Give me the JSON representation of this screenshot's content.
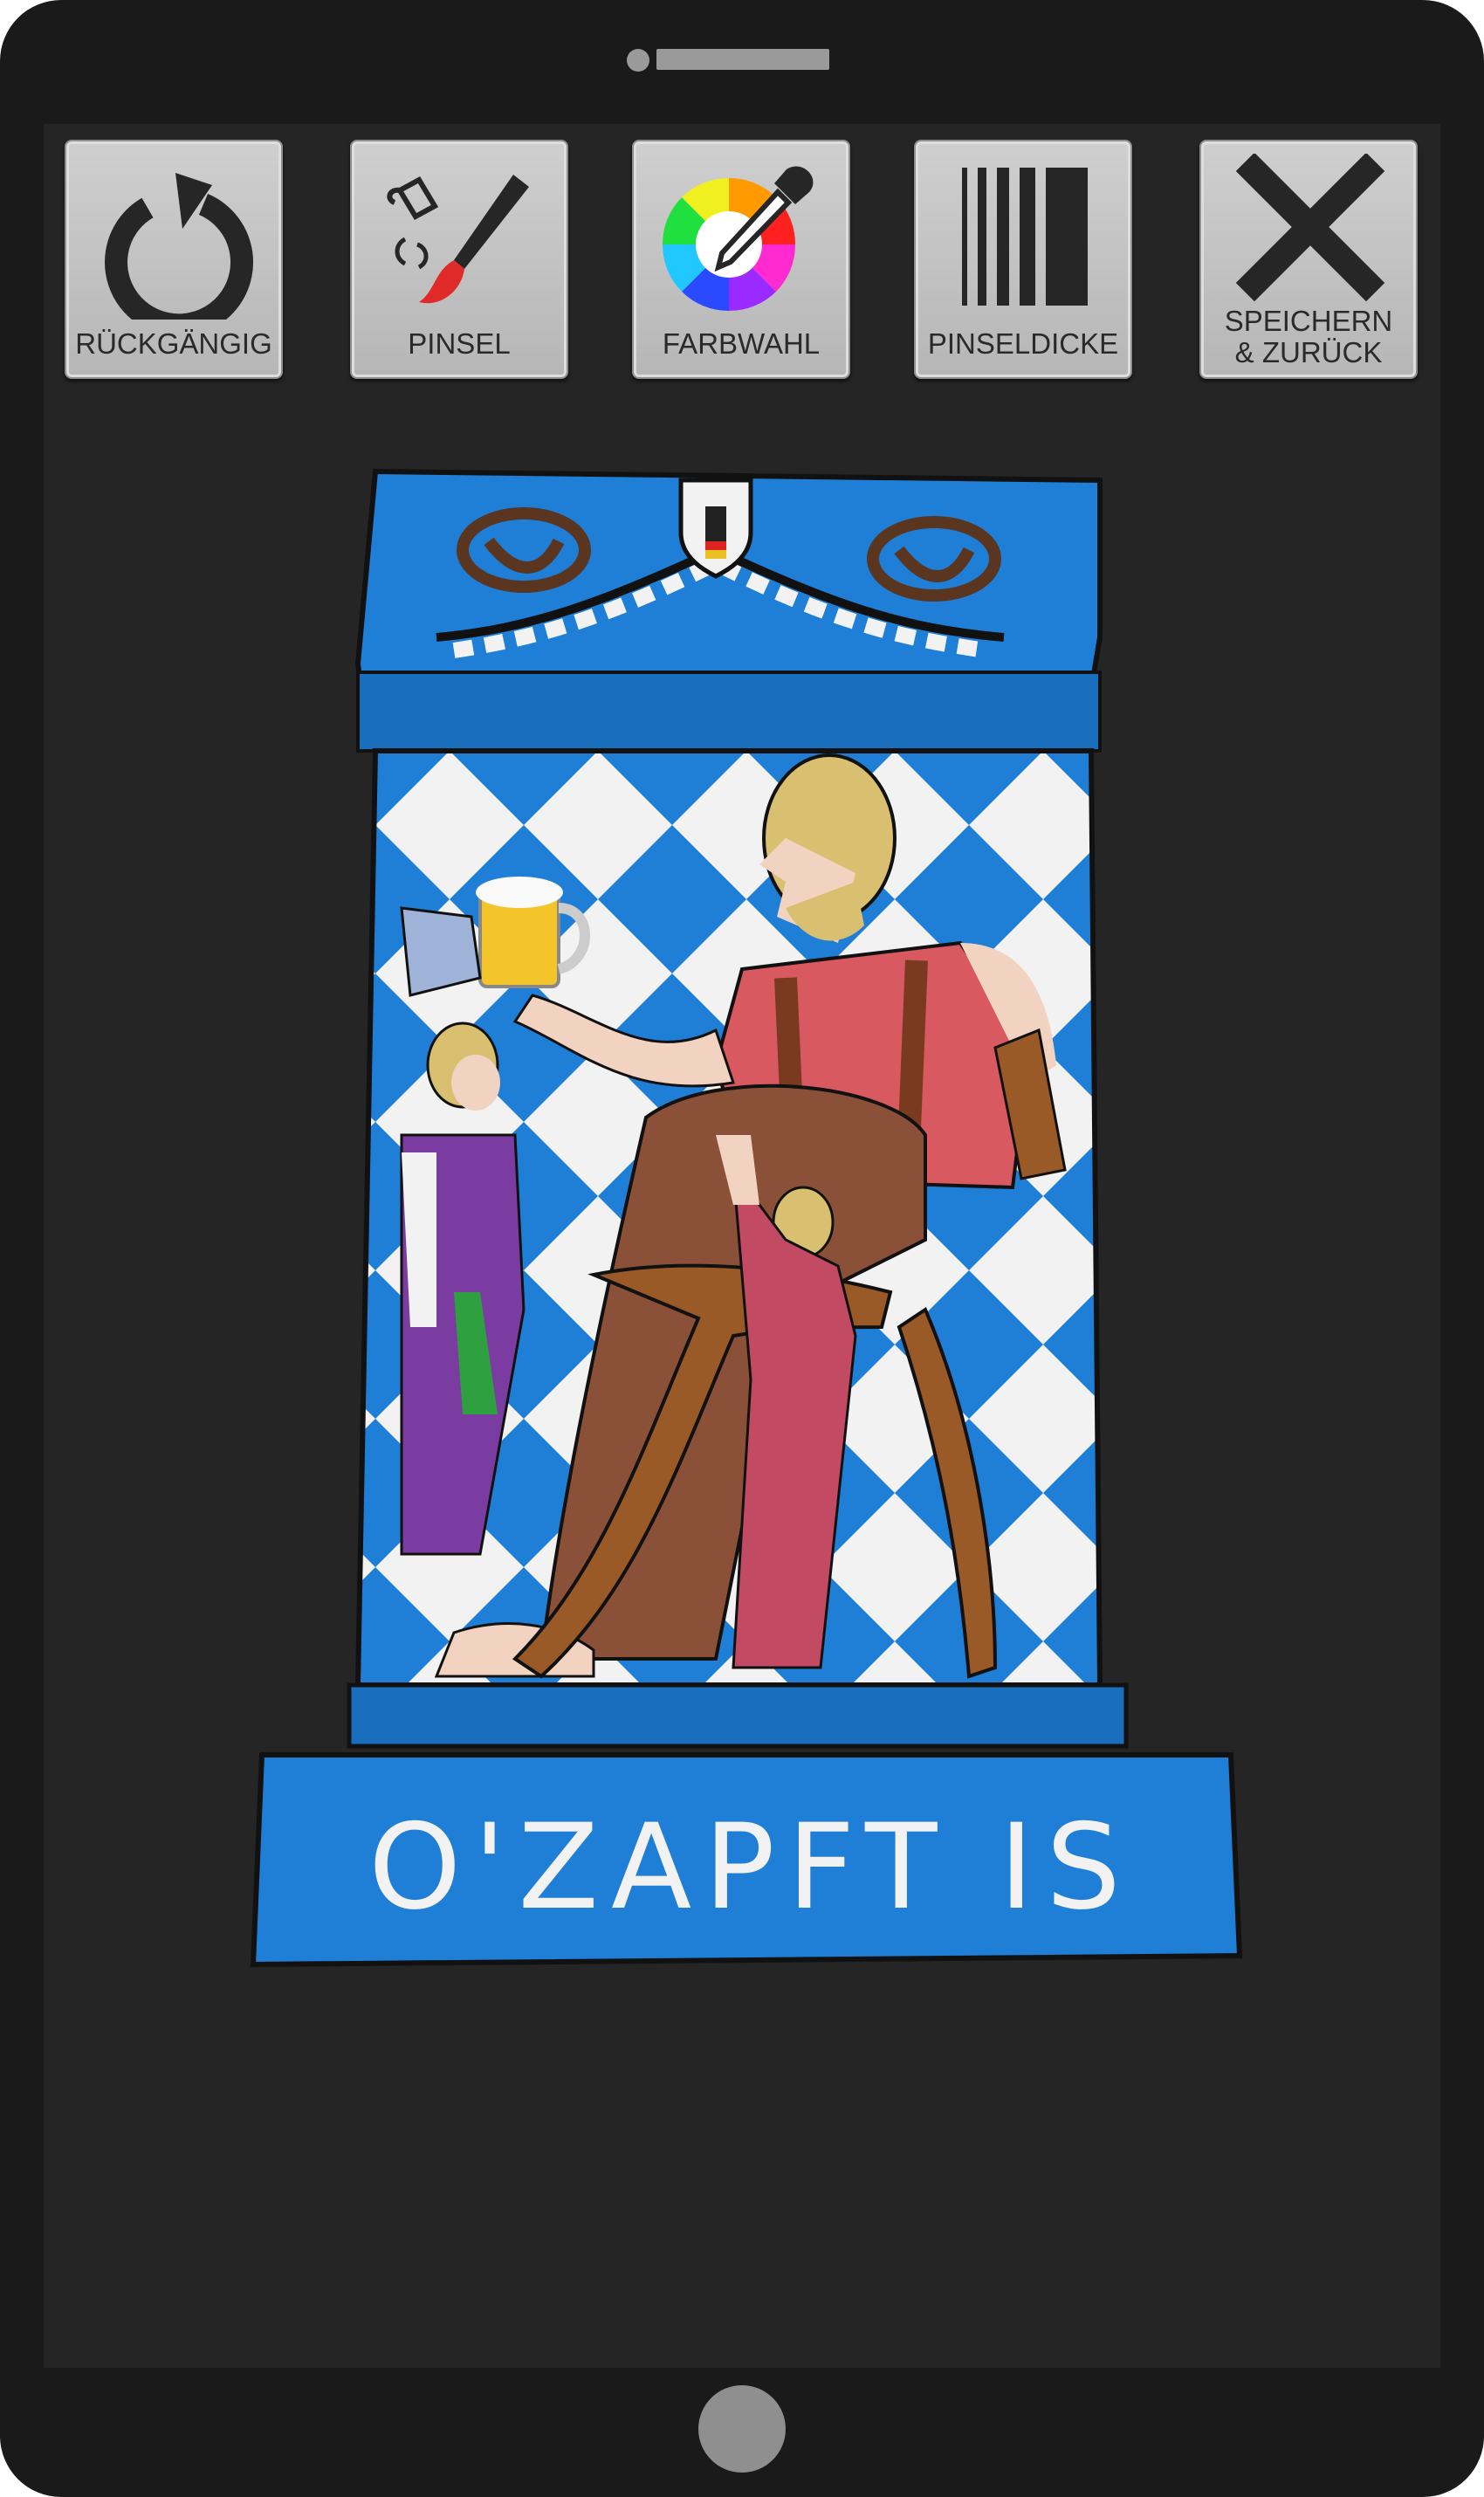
{
  "toolbar": {
    "undo_label": "RÜCKGÄNGIG",
    "brush_label": "PINSEL",
    "color_label": "FARBWAHL",
    "brush_size_label": "PINSELDICKE",
    "save_label": "SPEICHERN\n& ZURÜCK",
    "icons": [
      "undo-icon",
      "brush-icon",
      "color-wheel-icon",
      "brush-size-icon",
      "close-icon"
    ]
  },
  "canvas": {
    "sculpture_text": "O'ZAPFT IS",
    "colors": {
      "bavarian_blue": "#1f7fd6",
      "white": "#f2f2f2",
      "pretzel_brown": "#5a3520",
      "robe_brown": "#8a5138",
      "shirt_red": "#d85a60",
      "chair_brown": "#9a5a28",
      "skin": "#f2d2c0",
      "hair_blond": "#d8c070",
      "child_purple": "#7a3ca0",
      "child_green": "#2ea040",
      "child_red": "#c24a62"
    }
  }
}
